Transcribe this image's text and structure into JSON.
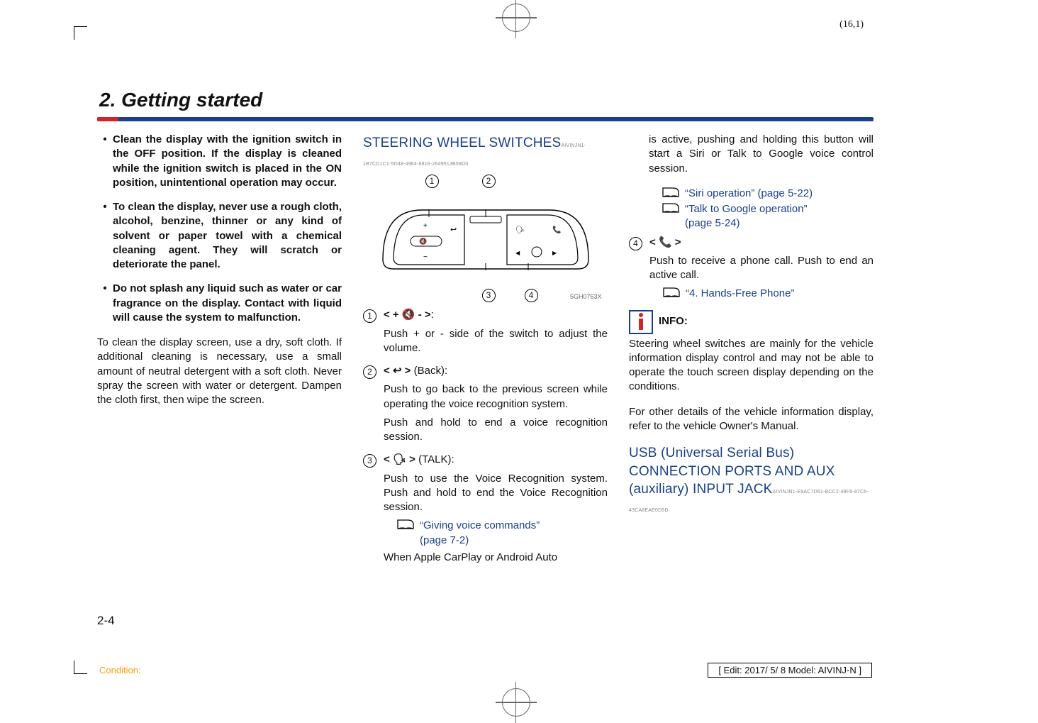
{
  "sheet_no": "(16,1)",
  "chapter_title": "2. Getting started",
  "col1": {
    "warnings": [
      "Clean the display with the ignition switch in the OFF position. If the display is cleaned while the ignition switch is placed in the ON position, unintentional operation may occur.",
      "To clean the display, never use a rough cloth, alcohol, benzine, thinner or any kind of solvent or paper towel with a chemical cleaning agent. They will scratch or deteriorate the panel.",
      "Do not splash any liquid such as water or car fragrance on the display. Contact with liquid will cause the system to malfunction."
    ],
    "para": "To clean the display screen, use a dry, soft cloth. If additional cleaning is necessary, use a small amount of neutral detergent with a soft cloth. Never spray the screen with water or detergent. Dampen the cloth first, then wipe the screen."
  },
  "col2": {
    "heading": "STEERING WHEEL SWITCHES",
    "guid": "AIVINJN1-1B7CD1C1-5D48-4964-8816-2649513B59D0",
    "figure_code": "5GH0763X",
    "items": [
      {
        "num": "①",
        "label_parts": {
          "open": "< +  ",
          "glyph": "🔇",
          "close": "  - >",
          "suffix": ":"
        },
        "paras": [
          "Push + or - side of the switch to adjust the volume."
        ]
      },
      {
        "num": "②",
        "label_parts": {
          "open": "<  ",
          "glyph": "↩",
          "close": "  >",
          "suffix": " (Back):"
        },
        "paras": [
          "Push to go back to the previous screen while operating the voice recognition system.",
          "Push and hold to end a voice recognition session."
        ]
      },
      {
        "num": "③",
        "label_parts": {
          "open": "<  ",
          "glyph": "🗣",
          "close": "  >",
          "suffix": " (TALK):"
        },
        "paras": [
          "Push to use the Voice Recognition system. Push and hold to end the Voice Recognition session."
        ],
        "refs": [
          {
            "text": "“Giving voice commands”",
            "page": "(page 7-2)"
          }
        ],
        "tail": "When Apple CarPlay or Android Auto"
      }
    ]
  },
  "col3": {
    "continue": "is active, pushing and holding this button will start a Siri or Talk to Google voice control session.",
    "refs_top": [
      {
        "text": "“Siri operation” (page 5-22)",
        "page": ""
      },
      {
        "text": "“Talk to Google operation”",
        "page": "(page 5-24)"
      }
    ],
    "item4": {
      "num": "④",
      "label_parts": {
        "open": "<  ",
        "glyph": "📞",
        "close": "  >"
      },
      "paras": [
        "Push to receive a phone call. Push to end an active call."
      ],
      "refs": [
        {
          "text": "“4. Hands-Free Phone”",
          "page": ""
        }
      ]
    },
    "info_label": "INFO:",
    "info_para1": "Steering wheel switches are mainly for the vehicle information display control and may not be able to operate the touch screen display depending on the conditions.",
    "info_para2": "For other details of the vehicle information display, refer to the vehicle Owner's Manual.",
    "heading2": "USB (Universal Serial Bus) CONNECTION PORTS AND AUX (auxiliary) INPUT JACK",
    "guid2": "AIVINJN1-E9AC7D61-BCC2-48F6-87C6-43CA8EAE0D5D"
  },
  "page_num": "2-4",
  "condition": "Condition:",
  "edit_info": "[ Edit: 2017/ 5/ 8    Model:  AIVINJ-N ]"
}
